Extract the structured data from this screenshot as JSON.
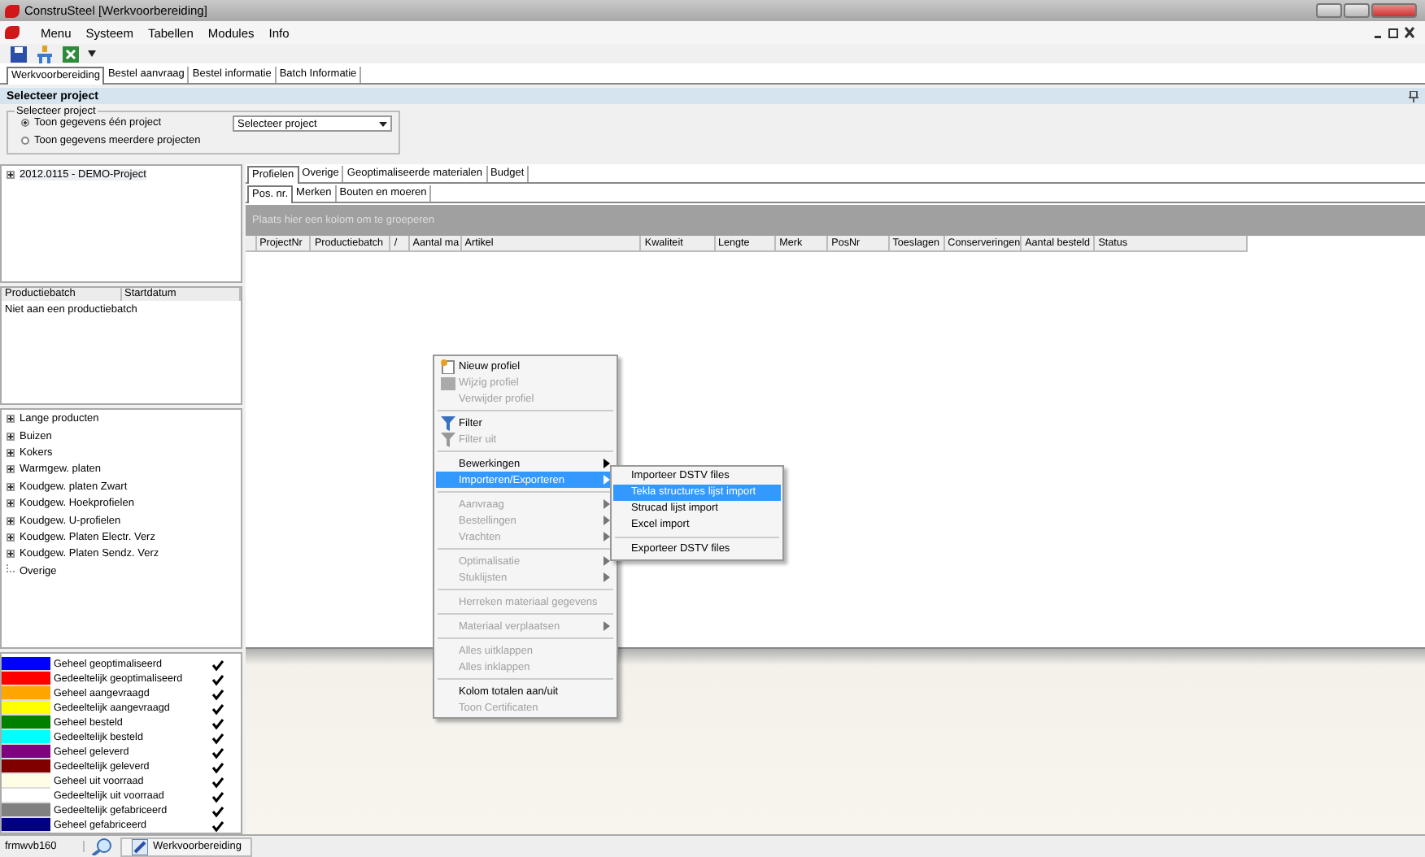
{
  "window": {
    "title": "ConstruSteel [Werkvoorbereiding]"
  },
  "menu": [
    "Menu",
    "Systeem",
    "Tabellen",
    "Modules",
    "Info"
  ],
  "doc_tabs": [
    {
      "label": "Werkvoorbereiding",
      "selected": true
    },
    {
      "label": "Bestel aanvraag",
      "selected": false
    },
    {
      "label": "Bestel informatie",
      "selected": false
    },
    {
      "label": "Batch Informatie",
      "selected": false
    }
  ],
  "section_title": "Selecteer project",
  "project_group": {
    "legend": "Selecteer project",
    "options": [
      {
        "label": "Toon gegevens één project",
        "selected": true
      },
      {
        "label": "Toon gegevens meerdere projecten",
        "selected": false
      }
    ],
    "dropdown": "Selecteer project"
  },
  "project_tree": [
    {
      "label": "2012.0115 - DEMO-Project",
      "expanded": false
    }
  ],
  "batch_table": {
    "columns": [
      "Productiebatch",
      "Startdatum"
    ],
    "rows": [
      "Niet aan een productiebatch"
    ]
  },
  "product_tree": [
    {
      "label": "Lange producten",
      "expandable": true
    },
    {
      "label": "Buizen",
      "expandable": true
    },
    {
      "label": "Kokers",
      "expandable": true
    },
    {
      "label": "Warmgew. platen",
      "expandable": true
    },
    {
      "label": "Koudgew. platen Zwart",
      "expandable": true
    },
    {
      "label": "Koudgew. Hoekprofielen",
      "expandable": true
    },
    {
      "label": "Koudgew. U-profielen",
      "expandable": true
    },
    {
      "label": "Koudgew. Platen Electr. Verz",
      "expandable": true
    },
    {
      "label": "Koudgew. Platen Sendz. Verz",
      "expandable": true
    },
    {
      "label": "Overige",
      "expandable": false
    }
  ],
  "legend": [
    {
      "label": "Geheel geoptimaliseerd",
      "color": "#0000ff",
      "checked": true
    },
    {
      "label": "Gedeeltelijk geoptimaliseerd",
      "color": "#ff0000",
      "checked": true
    },
    {
      "label": "Geheel aangevraagd",
      "color": "#ffa500",
      "checked": true
    },
    {
      "label": "Gedeeltelijk aangevraagd",
      "color": "#ffff00",
      "checked": true
    },
    {
      "label": "Geheel besteld",
      "color": "#008000",
      "checked": true
    },
    {
      "label": "Gedeeltelijk besteld",
      "color": "#00ffff",
      "checked": true
    },
    {
      "label": "Geheel geleverd",
      "color": "#800080",
      "checked": true
    },
    {
      "label": "Gedeeltelijk geleverd",
      "color": "#800000",
      "checked": true
    },
    {
      "label": "Geheel uit voorraad",
      "color": "#fffde6",
      "checked": true
    },
    {
      "label": "Gedeeltelijk uit voorraad",
      "color": "#ffffff",
      "checked": true
    },
    {
      "label": "Gedeeltelijk gefabriceerd",
      "color": "#808080",
      "checked": true
    },
    {
      "label": "Geheel gefabriceerd",
      "color": "#000080",
      "checked": true
    }
  ],
  "main_tabs": [
    {
      "label": "Profielen",
      "selected": true
    },
    {
      "label": "Overige",
      "selected": false
    },
    {
      "label": "Geoptimaliseerde materialen",
      "selected": false
    },
    {
      "label": "Budget",
      "selected": false
    }
  ],
  "sub_tabs": [
    {
      "label": "Pos. nr.",
      "selected": true
    },
    {
      "label": "Merken",
      "selected": false
    },
    {
      "label": "Bouten en moeren",
      "selected": false
    }
  ],
  "group_hint": "Plaats hier een kolom om te groeperen",
  "grid_columns": [
    "ProjectNr",
    "Productiebatch",
    "/",
    "Aantal ma",
    "Artikel",
    "Kwaliteit",
    "Lengte",
    "Merk",
    "PosNr",
    "Toeslagen",
    "Conserveringen",
    "Aantal besteld",
    "Status"
  ],
  "context_menu": [
    {
      "kind": "new",
      "label": "Nieuw profiel",
      "disabled": false,
      "submenu": false,
      "selected": false
    },
    {
      "kind": "edit",
      "label": "Wijzig profiel",
      "disabled": true,
      "submenu": false,
      "selected": false
    },
    {
      "kind": "plain",
      "label": "Verwijder profiel",
      "disabled": true,
      "submenu": false,
      "selected": false
    },
    {
      "kind": "separator"
    },
    {
      "kind": "filter",
      "label": "Filter",
      "disabled": false,
      "submenu": false,
      "selected": false
    },
    {
      "kind": "filter",
      "label": "Filter uit",
      "disabled": true,
      "submenu": false,
      "selected": false
    },
    {
      "kind": "separator"
    },
    {
      "kind": "plain",
      "label": "Bewerkingen",
      "disabled": false,
      "submenu": true,
      "selected": false
    },
    {
      "kind": "plain",
      "label": "Importeren/Exporteren",
      "disabled": false,
      "submenu": true,
      "selected": true
    },
    {
      "kind": "separator"
    },
    {
      "kind": "plain",
      "label": "Aanvraag",
      "disabled": true,
      "submenu": true,
      "selected": false
    },
    {
      "kind": "plain",
      "label": "Bestellingen",
      "disabled": true,
      "submenu": true,
      "selected": false
    },
    {
      "kind": "plain",
      "label": "Vrachten",
      "disabled": true,
      "submenu": true,
      "selected": false
    },
    {
      "kind": "separator"
    },
    {
      "kind": "plain",
      "label": "Optimalisatie",
      "disabled": true,
      "submenu": true,
      "selected": false
    },
    {
      "kind": "plain",
      "label": "Stuklijsten",
      "disabled": true,
      "submenu": true,
      "selected": false
    },
    {
      "kind": "separator"
    },
    {
      "kind": "plain",
      "label": "Herreken materiaal gegevens",
      "disabled": true,
      "submenu": false,
      "selected": false
    },
    {
      "kind": "separator"
    },
    {
      "kind": "plain",
      "label": "Materiaal verplaatsen",
      "disabled": true,
      "submenu": true,
      "selected": false
    },
    {
      "kind": "separator"
    },
    {
      "kind": "plain",
      "label": "Alles uitklappen",
      "disabled": true,
      "submenu": false,
      "selected": false
    },
    {
      "kind": "plain",
      "label": "Alles inklappen",
      "disabled": true,
      "submenu": false,
      "selected": false
    },
    {
      "kind": "separator"
    },
    {
      "kind": "plain",
      "label": "Kolom totalen aan/uit",
      "disabled": false,
      "submenu": false,
      "selected": false
    },
    {
      "kind": "plain",
      "label": "Toon Certificaten",
      "disabled": true,
      "submenu": false,
      "selected": false
    }
  ],
  "submenu": [
    {
      "kind": "item",
      "label": "Importeer DSTV files",
      "selected": false
    },
    {
      "kind": "item",
      "label": "Tekla structures lijst import",
      "selected": true
    },
    {
      "kind": "item",
      "label": "Strucad lijst import",
      "selected": false
    },
    {
      "kind": "item",
      "label": "Excel import",
      "selected": false
    },
    {
      "kind": "separator"
    },
    {
      "kind": "item",
      "label": "Exporteer DSTV files",
      "selected": false
    }
  ],
  "status_bar": {
    "form": "frmwvb160",
    "task": "Werkvoorbereiding"
  }
}
